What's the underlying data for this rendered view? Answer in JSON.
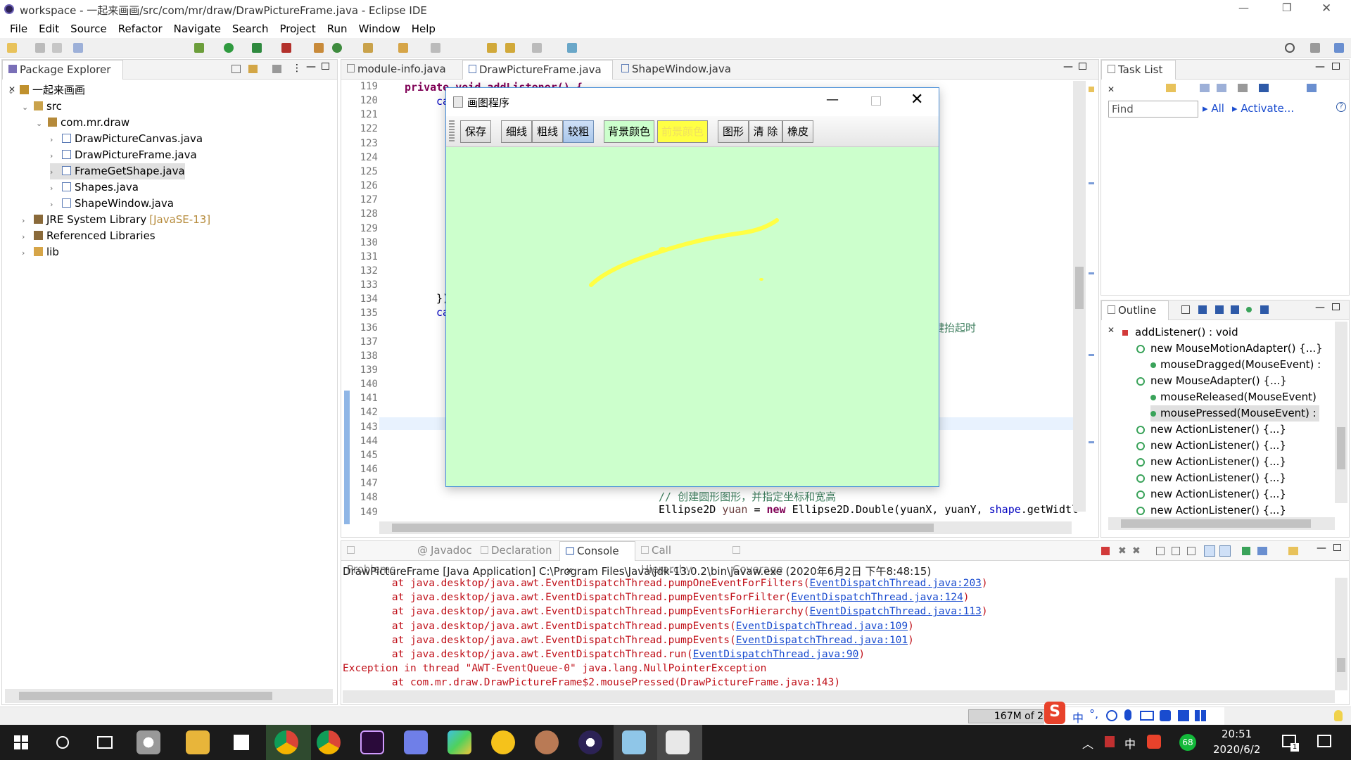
{
  "window": {
    "title": "workspace - 一起来画画/src/com/mr/draw/DrawPictureFrame.java - Eclipse IDE",
    "controls": {
      "minimize": "—",
      "maximize": "❐",
      "close": "✕"
    }
  },
  "menu": [
    "File",
    "Edit",
    "Source",
    "Refactor",
    "Navigate",
    "Search",
    "Project",
    "Run",
    "Window",
    "Help"
  ],
  "package_explorer": {
    "tab_label": "Package Explorer",
    "tree": [
      {
        "label": "一起来画画",
        "depth": 0,
        "expanded": true,
        "icon": "project-icon"
      },
      {
        "label": "src",
        "depth": 1,
        "expanded": true,
        "icon": "source-folder-icon"
      },
      {
        "label": "com.mr.draw",
        "depth": 2,
        "expanded": true,
        "icon": "package-icon"
      },
      {
        "label": "DrawPictureCanvas.java",
        "depth": 3,
        "icon": "java-file-icon"
      },
      {
        "label": "DrawPictureFrame.java",
        "depth": 3,
        "icon": "java-file-icon"
      },
      {
        "label": "FrameGetShape.java",
        "depth": 3,
        "icon": "java-file-icon",
        "selected": true
      },
      {
        "label": "Shapes.java",
        "depth": 3,
        "icon": "java-file-icon"
      },
      {
        "label": "ShapeWindow.java",
        "depth": 3,
        "icon": "java-file-icon"
      },
      {
        "label": "JRE System Library",
        "suffix": "[JavaSE-13]",
        "depth": 1,
        "icon": "library-icon"
      },
      {
        "label": "Referenced Libraries",
        "depth": 1,
        "icon": "library-icon"
      },
      {
        "label": "lib",
        "depth": 1,
        "icon": "folder-icon"
      }
    ]
  },
  "editor": {
    "tabs": [
      "module-info.java",
      "DrawPictureFrame.java",
      "ShapeWindow.java"
    ],
    "active_tab": 1,
    "line_numbers": [
      "119",
      "120",
      "121",
      "122",
      "123",
      "124",
      "125",
      "126",
      "127",
      "128",
      "129",
      "130",
      "131",
      "132",
      "133",
      "134",
      "135",
      "136",
      "137",
      "138",
      "139",
      "140",
      "141",
      "142",
      "143",
      "144",
      "145",
      "146",
      "147",
      "148",
      "149"
    ],
    "visible_code": {
      "line119": "private void addListener() {",
      "line120": "ca",
      "line134": "});",
      "line135": "ca",
      "line136_tail": "键抬起时",
      "line148": "// 创建圆形图形，并指定坐标和宽高",
      "line149_type": "Ellipse2D",
      "line149_var": "yuan",
      "line149_eq": " = ",
      "line149_new": "new",
      "line149_rest": " Ellipse2D.Double(yuanX, yuanY, ",
      "line149_shape": "shape",
      "line149_end": ".getWidtl"
    }
  },
  "swing_dialog": {
    "title": "画图程序",
    "buttons": [
      "保存",
      "细线",
      "粗线",
      "较粗",
      "背景颜色",
      "前景颜色",
      "图形",
      "清 除",
      "橡皮"
    ],
    "canvas_color": "#ccffcc",
    "stroke_color": "#ffff44"
  },
  "task_list": {
    "tab_label": "Task List",
    "find_placeholder": "Find",
    "all_label": "All",
    "activate_label": "Activate..."
  },
  "outline": {
    "tab_label": "Outline",
    "items": [
      {
        "label": "addListener() : void",
        "depth": 0
      },
      {
        "label": "new MouseMotionAdapter() {...}",
        "depth": 1
      },
      {
        "label": "mouseDragged(MouseEvent) :",
        "depth": 2
      },
      {
        "label": "new MouseAdapter() {...}",
        "depth": 1
      },
      {
        "label": "mouseReleased(MouseEvent)",
        "depth": 2
      },
      {
        "label": "mousePressed(MouseEvent) :",
        "depth": 2,
        "selected": true
      },
      {
        "label": "new ActionListener() {...}",
        "depth": 1
      },
      {
        "label": "new ActionListener() {...}",
        "depth": 1
      },
      {
        "label": "new ActionListener() {...}",
        "depth": 1
      },
      {
        "label": "new ActionListener() {...}",
        "depth": 1
      },
      {
        "label": "new ActionListener() {...}",
        "depth": 1
      },
      {
        "label": "new ActionListener() {...}",
        "depth": 1
      }
    ]
  },
  "bottom_tabs": [
    "Problems",
    "Javadoc",
    "Declaration",
    "Console",
    "Call Hierarchy",
    "Coverage"
  ],
  "bottom_active": 3,
  "console": {
    "header": "DrawPictureFrame [Java Application] C:\\Program Files\\Java\\jdk-13.0.2\\bin\\javaw.exe (2020年6月2日 下午8:48:15)",
    "lines": [
      {
        "text": "        at java.desktop/java.awt.EventDispatchThread.pumpOneEventForFilters(",
        "link": "EventDispatchThread.java:203",
        "end": ")"
      },
      {
        "text": "        at java.desktop/java.awt.EventDispatchThread.pumpEventsForFilter(",
        "link": "EventDispatchThread.java:124",
        "end": ")"
      },
      {
        "text": "        at java.desktop/java.awt.EventDispatchThread.pumpEventsForHierarchy(",
        "link": "EventDispatchThread.java:113",
        "end": ")"
      },
      {
        "text": "        at java.desktop/java.awt.EventDispatchThread.pumpEvents(",
        "link": "EventDispatchThread.java:109",
        "end": ")"
      },
      {
        "text": "        at java.desktop/java.awt.EventDispatchThread.pumpEvents(",
        "link": "EventDispatchThread.java:101",
        "end": ")"
      },
      {
        "text": "        at java.desktop/java.awt.EventDispatchThread.run(",
        "link": "EventDispatchThread.java:90",
        "end": ")"
      },
      {
        "text": "Exception in thread \"AWT-EventQueue-0\" java.lang.NullPointerException",
        "link": "",
        "end": ""
      },
      {
        "text": "        at com.mr.draw.DrawPictureFrame$2.mousePressed(DrawPictureFrame.java:143)",
        "link": "",
        "end": ""
      }
    ]
  },
  "status_bar": {
    "heap": "167M of 2"
  },
  "taskbar": {
    "time": "20:51",
    "date": "2020/6/2",
    "ime": "中",
    "ime_tray": "中",
    "badge": "68",
    "notification_count": "1",
    "apps": [
      "explorer-icon",
      "store-icon",
      "chrome-icon",
      "premiere-icon",
      "krita-icon",
      "player-icon",
      "qq-icon",
      "photo-icon",
      "eclipse-icon",
      "notepad-icon",
      "java-icon"
    ]
  }
}
